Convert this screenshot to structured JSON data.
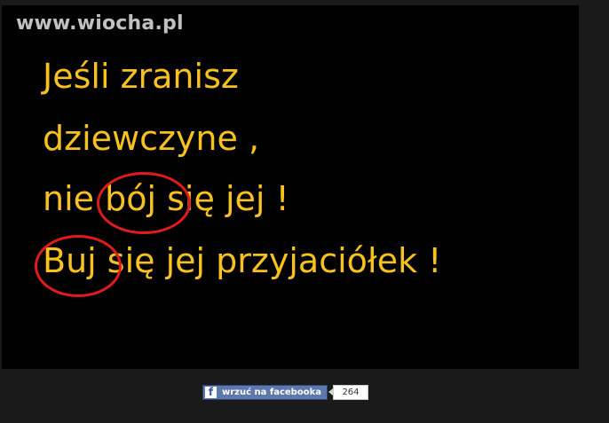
{
  "watermark": {
    "text": "www.wiocha.pl"
  },
  "meme": {
    "line1": "Jeśli zranisz",
    "line2": "dziewczyne ,",
    "line3": {
      "before": "nie ",
      "circled": "bój",
      "after": " się jej !"
    },
    "line4": {
      "circled": "Buj",
      "after": " się jej przyjaciółek !"
    },
    "text_color": "#f7c21d",
    "circle_color": "#e01b1b",
    "background": "#000000"
  },
  "share": {
    "icon": "facebook-icon",
    "icon_glyph": "f",
    "button_label": "wrzuć na facebooka",
    "count": "264",
    "button_color": "#5f78ab"
  }
}
